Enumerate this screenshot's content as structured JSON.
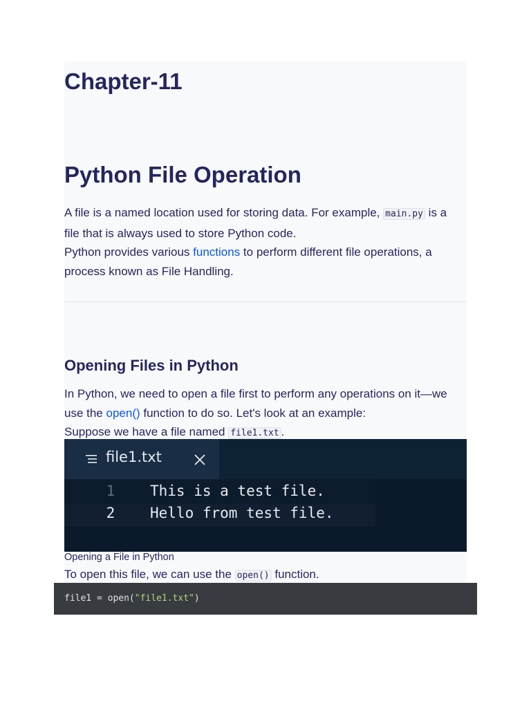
{
  "chapter_title": "Chapter-11",
  "section_title": "Python File Operation",
  "intro": {
    "p1_before": "A file is a named location used for storing data. For example, ",
    "p1_code": "main.py",
    "p1_after": " is a file that is always used to store Python code.",
    "p2_before": "Python provides various ",
    "p2_link": "functions",
    "p2_after": " to perform different file operations, a process known as File Handling."
  },
  "opening": {
    "heading": "Opening Files in Python",
    "p1_before": "In Python, we need to open a file first to perform any operations on it—we use the ",
    "p1_link": "open()",
    "p1_after": " function to do so. Let's look at an example:",
    "p2_before": "Suppose we have a file named ",
    "p2_code": "file1.txt",
    "p2_after": "."
  },
  "editor": {
    "tab_label": "file1.txt",
    "menu_icon": "menu-lines-icon",
    "close_icon": "close-icon",
    "lines": [
      {
        "number": "1",
        "text": "This is a test file."
      },
      {
        "number": "2",
        "text": "Hello from test file."
      }
    ],
    "colors": {
      "background": "#0b1a2a",
      "tab": "#192e45",
      "text": "#e6ebf1"
    }
  },
  "caption": "Opening a File in Python",
  "open_text": {
    "before": "To open this file, we can use the ",
    "code": "open()",
    "after": " function."
  },
  "code_example": {
    "prefix": "file1 = open(",
    "string": "\"file1.txt\"",
    "suffix": ")"
  },
  "colors": {
    "heading": "#25265e",
    "link": "#0556f3",
    "code_block_bg": "#383b40",
    "string": "#b5d67a"
  }
}
